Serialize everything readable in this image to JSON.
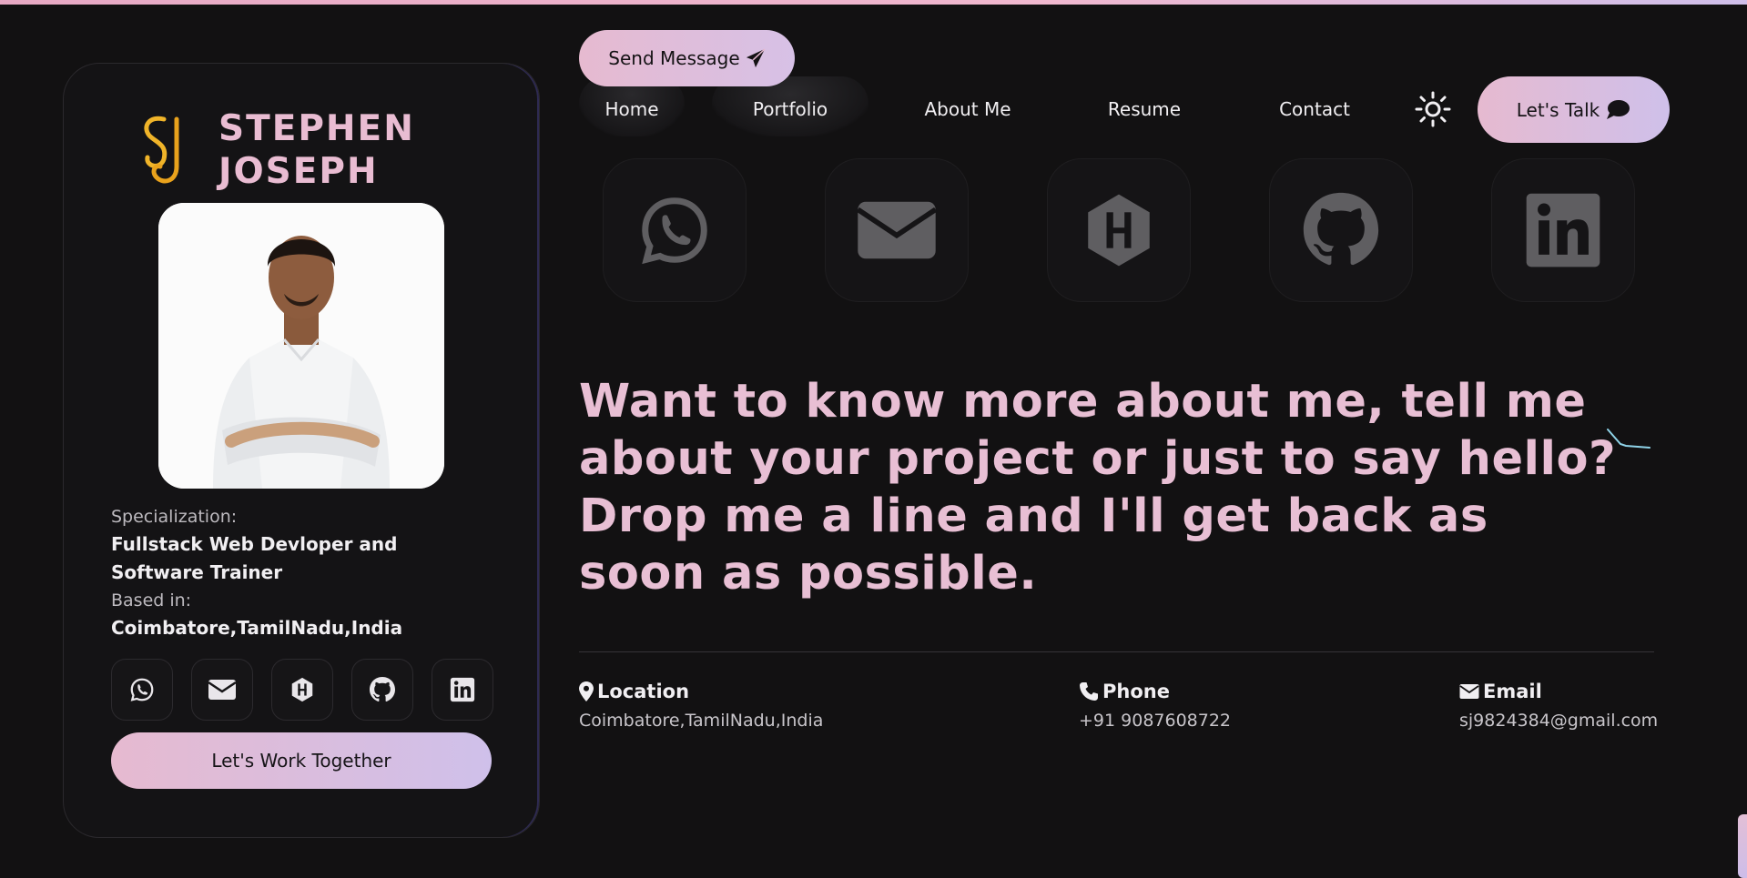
{
  "profile": {
    "name_line1": "STEPHEN",
    "name_line2": "JOSEPH",
    "specialization_label": "Specialization:",
    "specialization_value": "Fullstack Web Devloper and Software Trainer",
    "based_label": "Based in:",
    "based_value": "Coimbatore,TamilNadu,India",
    "cta": "Let's Work Together"
  },
  "nav": {
    "send_message": "Send Message",
    "items": [
      "Home",
      "Portfolio",
      "About Me",
      "Resume",
      "Contact"
    ],
    "lets_talk": "Let's Talk"
  },
  "social_icons": [
    "whatsapp-icon",
    "mail-icon",
    "hashnode-icon",
    "github-icon",
    "linkedin-icon"
  ],
  "headline": "Want to know more about me, tell me about your project or just to say hello? Drop me a line and I'll get back as soon as possible.",
  "contact": {
    "location_label": "Location",
    "location_value": "Coimbatore,TamilNadu,India",
    "phone_label": "Phone",
    "phone_value": "+91 9087608722",
    "email_label": "Email",
    "email_value": "sj9824384@gmail.com"
  },
  "colors": {
    "background": "#121112",
    "accent_pink": "#e8bfd4",
    "accent_lavender": "#cfc0ea",
    "logo_gold": "#f0b429"
  }
}
